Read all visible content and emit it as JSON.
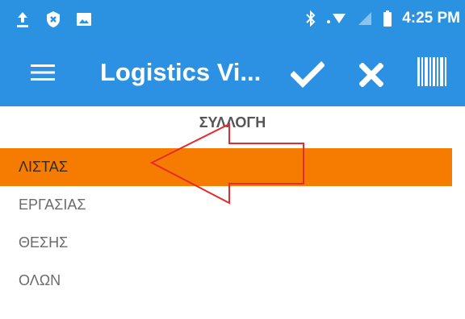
{
  "status_bar": {
    "time": "4:25 PM",
    "left_icons": [
      "upload-icon",
      "shield-icon",
      "image-icon"
    ],
    "right_icons": [
      "bluetooth-icon",
      "wifi-icon",
      "signal-icon",
      "battery-icon"
    ]
  },
  "app_bar": {
    "title": "Logistics Vi...",
    "actions": [
      "check-icon",
      "close-icon",
      "barcode-icon"
    ]
  },
  "section": {
    "title": "ΣΥΛΛΟΓΗ",
    "items": [
      {
        "label": "ΛΙΣΤΑΣ",
        "selected": true
      },
      {
        "label": "ΕΡΓΑΣΙΑΣ",
        "selected": false
      },
      {
        "label": "ΘΕΣΗΣ",
        "selected": false
      },
      {
        "label": "ΟΛΩΝ",
        "selected": false
      }
    ]
  },
  "colors": {
    "primary": "#2c91e3",
    "selected": "#f57c00",
    "annotation": "#e52b2b"
  }
}
